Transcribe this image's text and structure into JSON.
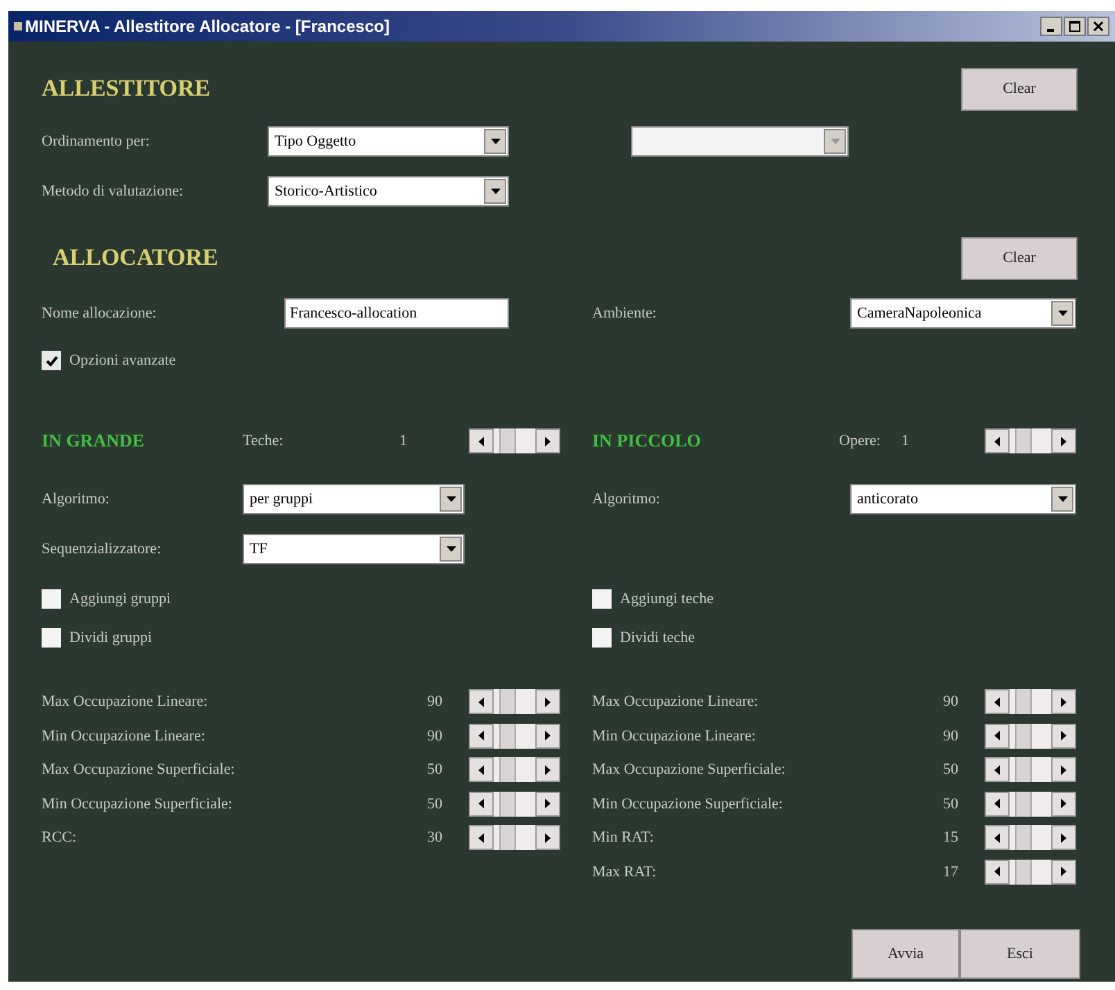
{
  "window": {
    "title": "MINERVA - Allestitore Allocatore - [Francesco]"
  },
  "allestitore": {
    "heading": "ALLESTITORE",
    "clear_button": "Clear",
    "fields": [
      {
        "label": "Ordinamento per:",
        "value": "Tipo Oggetto"
      },
      {
        "label": "Metodo di valutazione:",
        "value": "Storico-Artistico"
      }
    ],
    "extra_combo": {
      "disabled": true
    }
  },
  "allocatore": {
    "heading": "ALLOCATORE",
    "clear_button": "Clear",
    "name": {
      "label": "Nome allocazione:",
      "value": "Francesco-allocation"
    },
    "ambiente": {
      "label": "Ambiente:",
      "value": "CameraNapoleonica"
    },
    "advanced": {
      "label": "Opzioni avanzate",
      "checked": true
    }
  },
  "panels": [
    {
      "heading": "IN GRANDE",
      "count_label": "Teche:",
      "count": "1",
      "selectors": [
        {
          "label": "Algoritmo:",
          "value": "per gruppi"
        },
        {
          "label": "Sequenzializzatore:",
          "value": "TF"
        }
      ],
      "options": [
        {
          "label": "Aggiungi gruppi",
          "checked": false
        },
        {
          "label": "Dividi gruppi",
          "checked": false
        }
      ],
      "limits": [
        {
          "label": "Max Occupazione Lineare:",
          "value": "90"
        },
        {
          "label": "Min Occupazione Lineare:",
          "value": "90"
        },
        {
          "label": "Max Occupazione Superficiale:",
          "value": "50"
        },
        {
          "label": "Min Occupazione Superficiale:",
          "value": "50"
        },
        {
          "label": "RCC:",
          "value": "30"
        }
      ]
    },
    {
      "heading": "IN PICCOLO",
      "count_label": "Opere:",
      "count": "1",
      "selectors": [
        {
          "label": "Algoritmo:",
          "value": "anticorato"
        }
      ],
      "options": [
        {
          "label": "Aggiungi teche",
          "checked": false
        },
        {
          "label": "Dividi teche",
          "checked": false
        }
      ],
      "limits": [
        {
          "label": "Max Occupazione Lineare:",
          "value": "90"
        },
        {
          "label": "Min Occupazione Lineare:",
          "value": "90"
        },
        {
          "label": "Max Occupazione Superficiale:",
          "value": "50"
        },
        {
          "label": "Min Occupazione Superficiale:",
          "value": "50"
        },
        {
          "label": "Min RAT:",
          "value": "15"
        },
        {
          "label": "Max RAT:",
          "value": "17"
        }
      ]
    }
  ],
  "buttons": [
    "Avvia",
    "Esci"
  ]
}
